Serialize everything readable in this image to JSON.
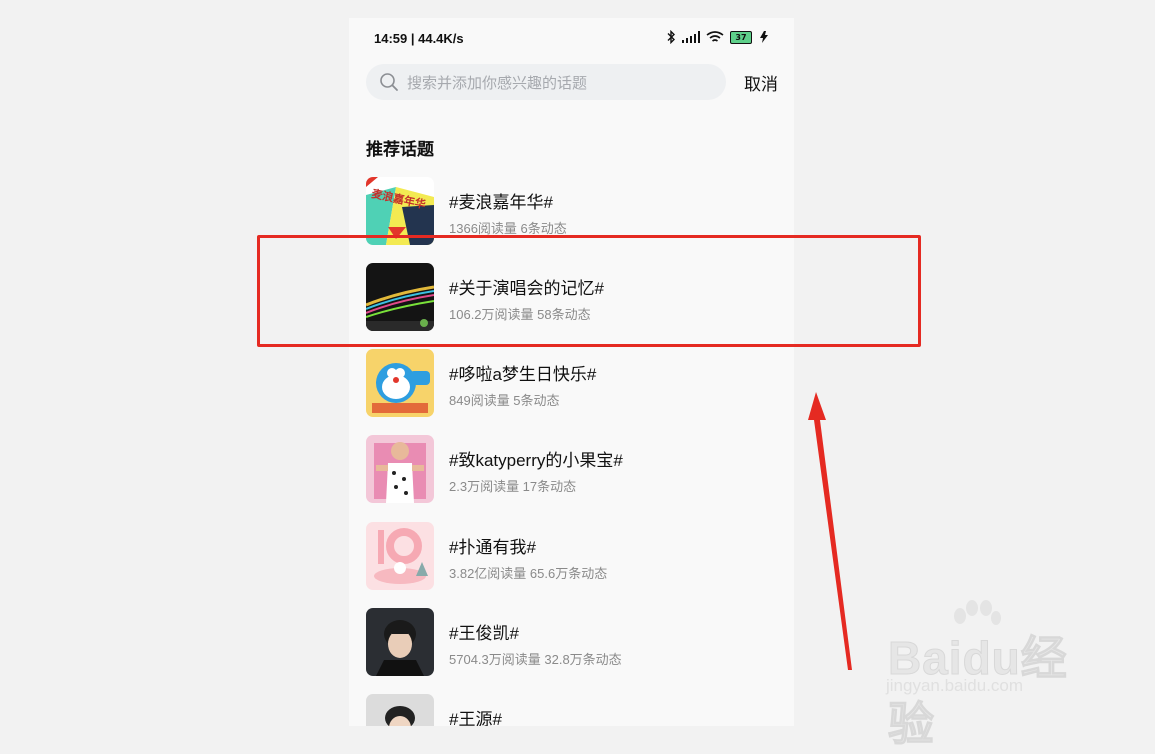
{
  "status_bar": {
    "time": "14:59 | 44.4K/s",
    "battery": "37"
  },
  "search": {
    "placeholder": "搜索并添加你感兴趣的话题",
    "cancel_label": "取消"
  },
  "section_title": "推荐话题",
  "topics": [
    {
      "title": "#麦浪嘉年华#",
      "stats": "1366阅读量 6条动态",
      "thumb_text": "麦浪嘉年华"
    },
    {
      "title": "#关于演唱会的记忆#",
      "stats": "106.2万阅读量 58条动态"
    },
    {
      "title": "#哆啦a梦生日快乐#",
      "stats": "849阅读量 5条动态"
    },
    {
      "title": "#致katyperry的小果宝#",
      "stats": "2.3万阅读量 17条动态"
    },
    {
      "title": "#扑通有我#",
      "stats": "3.82亿阅读量 65.6万条动态"
    },
    {
      "title": "#王俊凯#",
      "stats": "5704.3万阅读量 32.8万条动态"
    },
    {
      "title": "#王源#",
      "stats": ""
    }
  ],
  "watermark": {
    "brand": "Baidu经验",
    "url": "jingyan.baidu.com"
  },
  "colors": {
    "highlight": "#e52a22",
    "arrow": "#e52a22",
    "search_bg": "#eef0f2"
  }
}
